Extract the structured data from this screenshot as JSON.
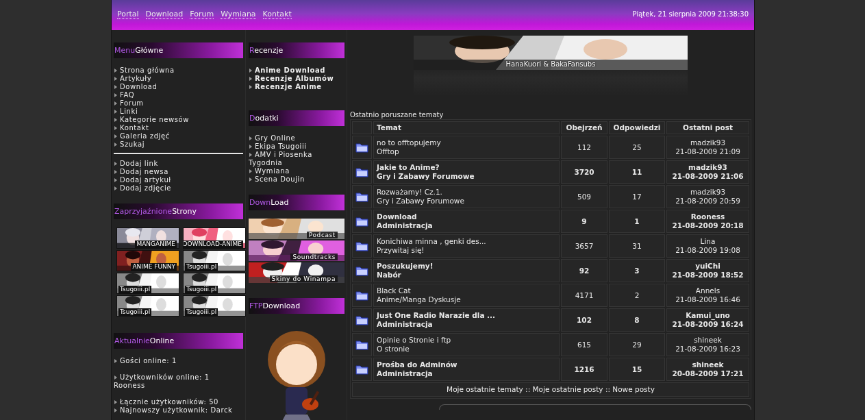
{
  "nav": {
    "links": [
      "Portal",
      "Download",
      "Forum",
      "Wymiana",
      "Kontakt"
    ],
    "date": "Piątek, 21 sierpnia 2009 21:38:30"
  },
  "menu": {
    "title_accent": "Menu",
    "title_rest": "Główne",
    "groups": [
      [
        "Strona główna",
        "Artykuły",
        "Download",
        "FAQ",
        "Forum",
        "Linki",
        "Kategorie newsów",
        "Kontakt",
        "Galeria zdjęć",
        "Szukaj"
      ],
      [
        "Dodaj link",
        "Dodaj newsa",
        "Dodaj artykuł",
        "Dodaj zdjęcie"
      ]
    ]
  },
  "friends": {
    "title_accent": "Zaprzyjaźnione",
    "title_rest": "Strony",
    "banners": [
      "MANGANIME",
      "DOWNLOAD-ANIME",
      "ANIME FUNNY",
      "Tsugoiii.pl",
      "Tsugoiii.pl",
      "Tsugoiii.pl",
      "Tsugoiii.pl",
      "Tsugoiii.pl"
    ]
  },
  "online": {
    "title_accent": "Aktualnie",
    "title_rest": "Online",
    "groups": [
      [
        {
          "text": "Gości online: 1",
          "bullet": true
        }
      ],
      [
        {
          "text": "Użytkowników online: 1",
          "bullet": true
        },
        {
          "text": "Rooness",
          "bullet": false
        }
      ],
      [
        {
          "text": "Łącznie użytkowników: 50",
          "bullet": true
        },
        {
          "text": "Najnowszy użytkownik: Darck",
          "bullet": true
        }
      ]
    ]
  },
  "reviews": {
    "title_accent": "R",
    "title_rest": "ecenzje",
    "items": [
      "Anime Download",
      "Recenzje Albumów",
      "Recenzje Anime"
    ]
  },
  "extras": {
    "title_accent": "D",
    "title_rest": "odatki",
    "items": [
      "Gry Online",
      "Ekipa Tsugoiii",
      "AMV i Piosenka Tygodnia",
      "Wymiana",
      "Scena Doujin"
    ]
  },
  "downloads": {
    "title_accent": "Down",
    "title_rest": "Load",
    "banners": [
      "Podcast",
      "Soundtracks",
      "Skiny do Winampa"
    ]
  },
  "ftp": {
    "title_accent": "FTP",
    "title_rest": "Download"
  },
  "top_banner": {
    "caption": "HanaKuori & BakaFansubs"
  },
  "topics": {
    "title": "Ostatnio poruszane tematy",
    "columns": [
      "Temat",
      "Obejrzeń",
      "Odpowiedzi",
      "Ostatni post"
    ],
    "rows": [
      {
        "title": "no to offtopujemy",
        "forum": "Offtop",
        "views": "112",
        "replies": "25",
        "author": "madzik93",
        "date": "21-08-2009 21:09",
        "bold": false
      },
      {
        "title": "Jakie to Anime?",
        "forum": "Gry i Zabawy Forumowe",
        "views": "3720",
        "replies": "11",
        "author": "madzik93",
        "date": "21-08-2009 21:06",
        "bold": true
      },
      {
        "title": "Rozważamy! Cz.1.",
        "forum": "Gry i Zabawy Forumowe",
        "views": "509",
        "replies": "17",
        "author": "madzik93",
        "date": "21-08-2009 20:59",
        "bold": false
      },
      {
        "title": "Download",
        "forum": "Administracja",
        "views": "9",
        "replies": "1",
        "author": "Rooness",
        "date": "21-08-2009 20:18",
        "bold": true
      },
      {
        "title": "Konichiwa minna , genki des...",
        "forum": "Przywitaj się!",
        "views": "3657",
        "replies": "31",
        "author": "Lina",
        "date": "21-08-2009 19:08",
        "bold": false
      },
      {
        "title": "Poszukujemy!",
        "forum": "Nabór",
        "views": "92",
        "replies": "3",
        "author": "yuiChi",
        "date": "21-08-2009 18:52",
        "bold": true
      },
      {
        "title": "Black Cat",
        "forum": "Anime/Manga Dyskusje",
        "views": "4171",
        "replies": "2",
        "author": "Annels",
        "date": "21-08-2009 16:46",
        "bold": false
      },
      {
        "title": "Just One Radio Narazie dla ...",
        "forum": "Administracja",
        "views": "102",
        "replies": "8",
        "author": "Kamui_uno",
        "date": "21-08-2009 16:24",
        "bold": true
      },
      {
        "title": "Opinie o Stronie i ftp",
        "forum": "O stronie",
        "views": "615",
        "replies": "29",
        "author": "shineek",
        "date": "21-08-2009 16:23",
        "bold": false
      },
      {
        "title": "Prośba do Adminów",
        "forum": "Administracja",
        "views": "1216",
        "replies": "15",
        "author": "shineek",
        "date": "20-08-2009 17:21",
        "bold": true
      }
    ],
    "footer_links": [
      "Moje ostatnie tematy",
      "Moje ostatnie posty",
      "Nowe posty"
    ],
    "separator": "::"
  }
}
